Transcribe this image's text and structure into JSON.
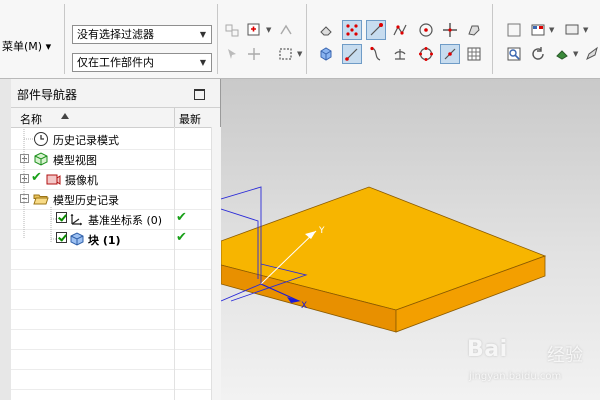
{
  "toolbar": {
    "menu_label": "菜单(M)",
    "menu_arrow": "▾",
    "selection_filter": "没有选择过滤器",
    "selection_scope": "仅在工作部件内",
    "combo_arrow": "▼"
  },
  "navigator": {
    "title": "部件导航器",
    "col_name": "名称",
    "col_latest": "最新",
    "items": [
      {
        "label": "历史记录模式"
      },
      {
        "label": "模型视图",
        "expander": "+"
      },
      {
        "label": "摄像机",
        "expander": "+"
      },
      {
        "label": "模型历史记录",
        "expander": "−"
      },
      {
        "label": "基准坐标系 (0)"
      },
      {
        "label": "块 (1)"
      }
    ],
    "latest_mark": "✔"
  },
  "viewport": {
    "axis_y": "Y",
    "axis_x": "X",
    "block_color": "#f6b400",
    "block_side_color": "#e08a00"
  },
  "watermark": {
    "brand": "Bai",
    "brand_cn": "经验",
    "url": "jingyan.baidu.com"
  }
}
